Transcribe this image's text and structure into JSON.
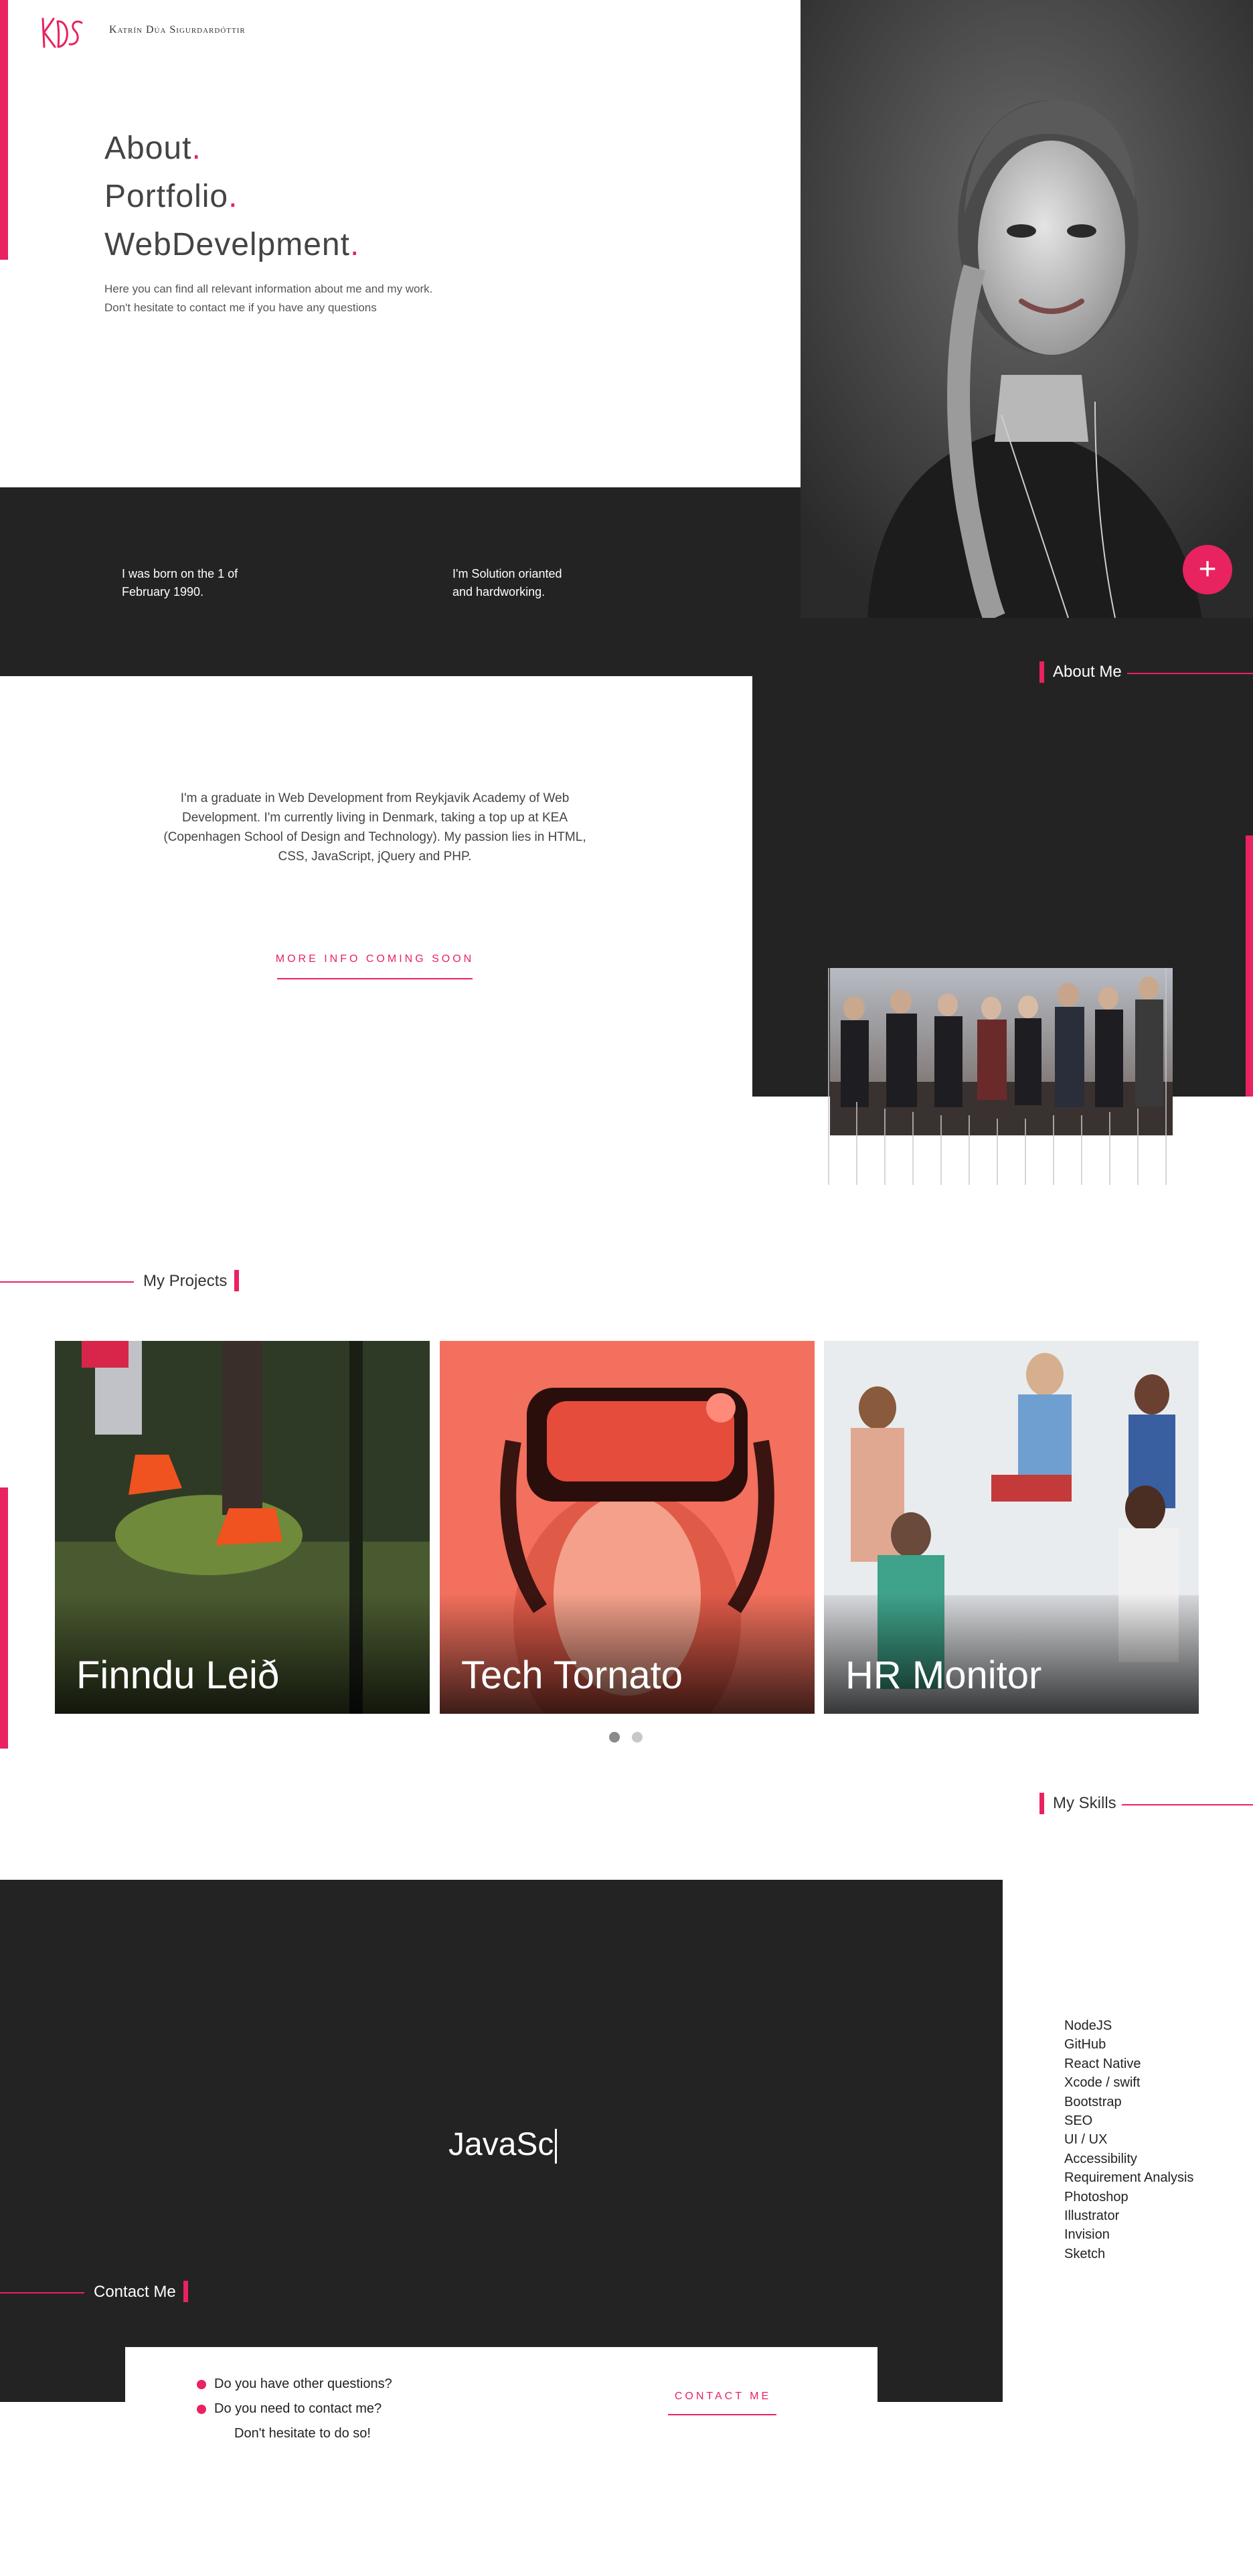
{
  "header": {
    "logo_text": "KDS",
    "brand_name": "Katrín Dúa Sigurdardóttir"
  },
  "hero": {
    "lines": [
      "About",
      "Portfolio",
      "WebDevelpment"
    ],
    "dot": ".",
    "subtitle_line1": "Here you can find all relevant information about me and my work.",
    "subtitle_line2": "Don't hesitate to contact me if you have any questions",
    "fab_label": "+"
  },
  "facts": {
    "fact1_line1": "I was born on the 1 of",
    "fact1_line2": "February 1990.",
    "fact2_line1": "I'm Solution orianted",
    "fact2_line2": "and hardworking."
  },
  "about": {
    "label": "About Me",
    "text": "I'm a graduate in Web Development from Reykjavik Academy of Web Development. I'm currently living in Denmark, taking a top up at KEA (Copenhagen School of Design and Technology). My passion lies in HTML, CSS, JavaScript, jQuery and PHP.",
    "more_link": "MORE INFO COMING SOON"
  },
  "projects": {
    "label": "My Projects",
    "cards": [
      {
        "title": "Finndu Leið"
      },
      {
        "title": "Tech Tornato"
      },
      {
        "title": "HR Monitor"
      }
    ],
    "pagination_count": 2,
    "pagination_active": 1
  },
  "skills": {
    "label": "My Skills",
    "typing_text": "JavaSc",
    "items": [
      "NodeJS",
      "GitHub",
      "React Native",
      "Xcode / swift",
      "Bootstrap",
      "SEO",
      "UI / UX",
      "Accessibility",
      "Requirement Analysis",
      "Photoshop",
      "Illustrator",
      "Invision",
      "Sketch"
    ]
  },
  "contact": {
    "label": "Contact Me",
    "q1": "Do you have other questions?",
    "q2": "Do you need to contact me?",
    "q3": "Don't hesitate to do so!",
    "button": "CONTACT ME"
  },
  "colors": {
    "accent": "#e8235f",
    "dark": "#232323",
    "white": "#ffffff"
  }
}
